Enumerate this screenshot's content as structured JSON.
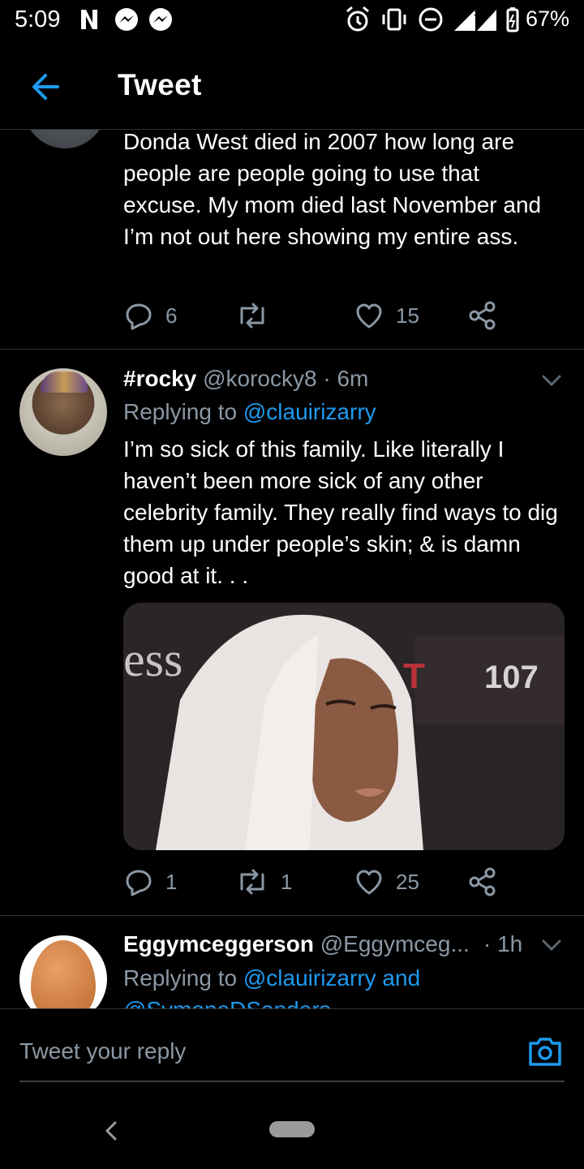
{
  "status_bar": {
    "time": "5:09",
    "battery": "67%",
    "network": "3G"
  },
  "header": {
    "title": "Tweet"
  },
  "tweet1": {
    "text": "Donda West died in 2007 how long are people are people going to use that excuse. My mom died last November and I’m not out here showing my entire ass.",
    "reply_count": "6",
    "retweet_count": "",
    "like_count": "15"
  },
  "tweet2": {
    "display_name": "#rocky",
    "handle": "@korocky8",
    "separator": "·",
    "time": "6m",
    "replying_prefix": "Replying to",
    "replying_to": "@clauirizarry",
    "text": "I’m so sick of this family. Like literally I haven’t been more sick of any other celebrity family. They really find ways to dig them up under people’s skin; & is damn good at it. . .",
    "reply_count": "1",
    "retweet_count": "1",
    "like_count": "25"
  },
  "tweet3": {
    "display_name": "Eggymceggerson",
    "handle": "@Eggymceg...",
    "separator": "·",
    "time": "1h",
    "replying_prefix": "Replying to",
    "replying_to": "@clauirizarry and",
    "replying_to_more": "@SymoneDSanders"
  },
  "reply_box": {
    "placeholder": "Tweet your reply"
  },
  "colors": {
    "accent": "#1d9bf0",
    "muted": "#8b98a5",
    "divider": "#2f3336"
  },
  "icons": [
    "back-arrow-icon",
    "reply-icon",
    "retweet-icon",
    "like-icon",
    "share-icon",
    "chevron-down-icon",
    "camera-icon",
    "nav-back-icon",
    "home-pill-icon"
  ]
}
